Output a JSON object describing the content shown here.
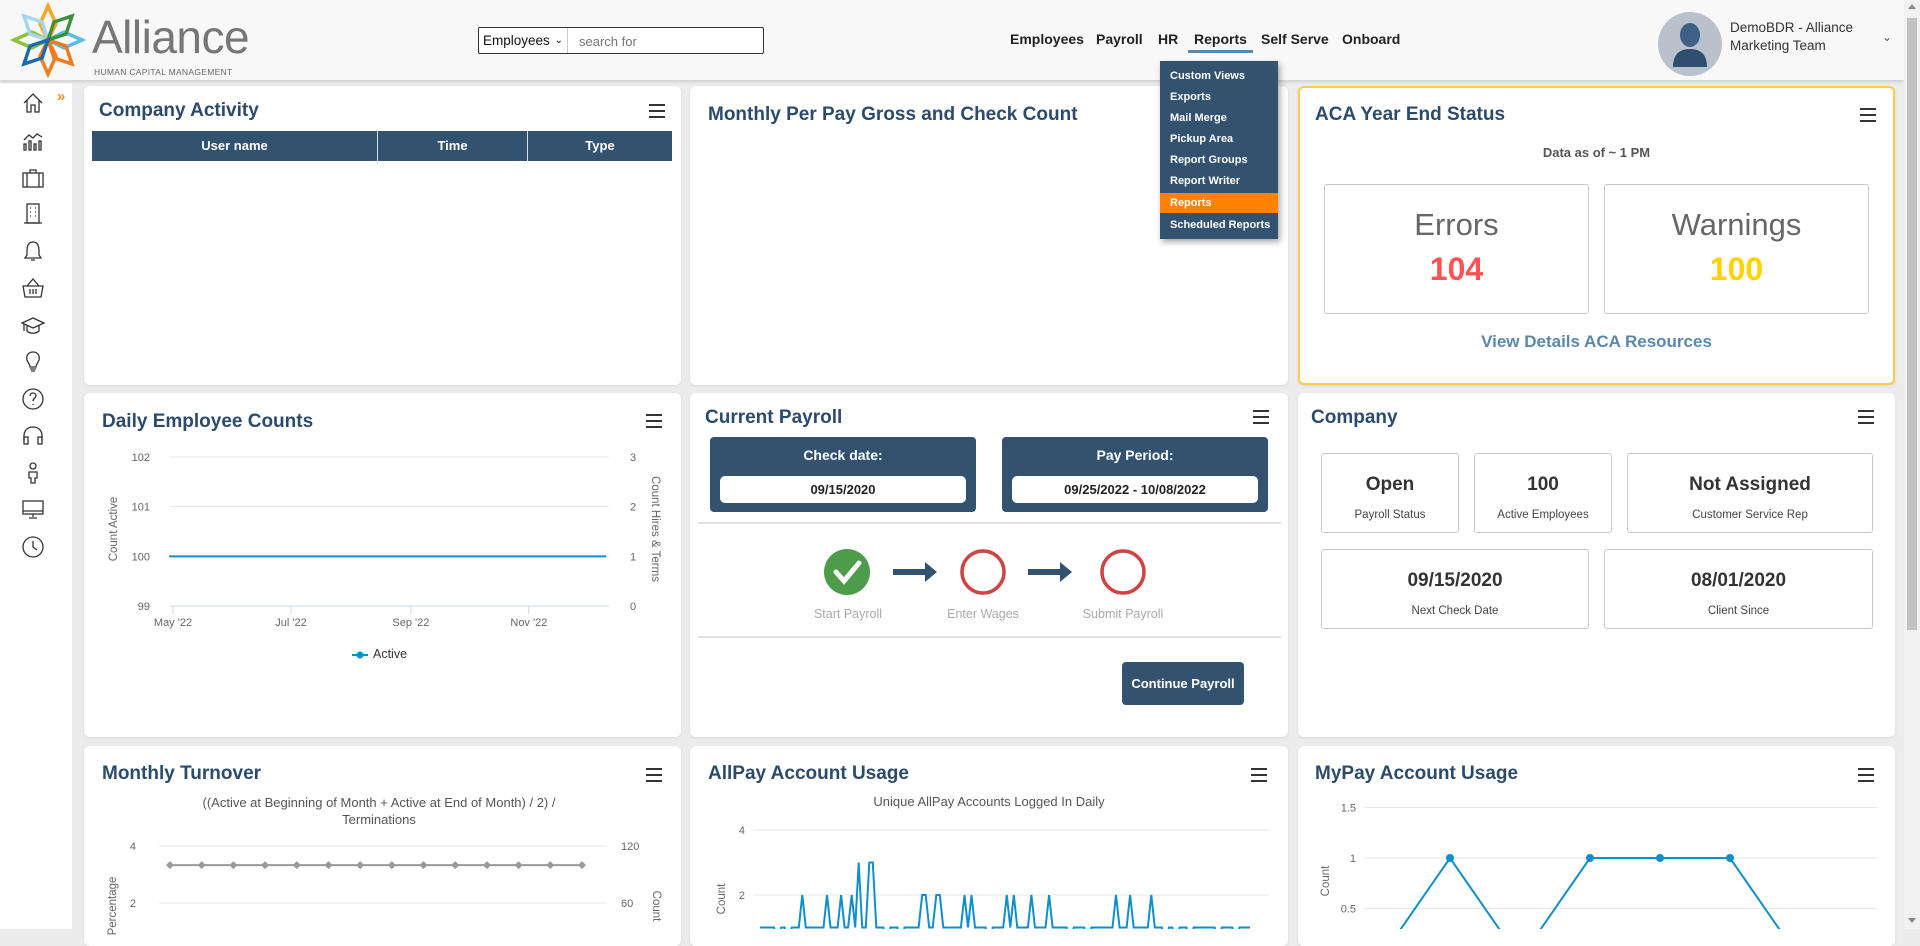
{
  "header": {
    "logo_text": "Alliance",
    "logo_sub": "HUMAN CAPITAL MANAGEMENT",
    "search_scope": "Employees",
    "search_placeholder": "search for",
    "nav": [
      {
        "label": "Employees"
      },
      {
        "label": "Payroll"
      },
      {
        "label": "HR"
      },
      {
        "label": "Reports"
      },
      {
        "label": "Self Serve"
      },
      {
        "label": "Onboard"
      }
    ],
    "active_nav": "Reports",
    "user": {
      "line1": "DemoBDR - Alliance",
      "line2": "Marketing Team"
    }
  },
  "reports_menu": {
    "items": [
      "Custom Views",
      "Exports",
      "Mail Merge",
      "Pickup Area",
      "Report Groups",
      "Report Writer",
      "Reports",
      "Scheduled Reports"
    ],
    "highlighted": "Reports"
  },
  "sidebar": {
    "icons": [
      "home-icon",
      "analytics-icon",
      "briefcase-icon",
      "building-icon",
      "bell-icon",
      "basket-icon",
      "graduation-cap-icon",
      "lightbulb-icon",
      "help-icon",
      "headset-icon",
      "person-icon",
      "monitor-icon",
      "clock-icon"
    ]
  },
  "colors": {
    "title": "#2c4b6b",
    "dark_panel": "#32526f",
    "menu_highlight": "#ff8200",
    "errors": "#ff5252",
    "warnings": "#ffd200",
    "aca_border": "#f9cc4a",
    "link": "#5b87ad",
    "series_blue": "#0f8fcc",
    "series_gray": "#999999",
    "step_complete": "#4c9c4a",
    "step_pending": "#cc4444"
  },
  "company_activity": {
    "title": "Company Activity",
    "columns": [
      "User name",
      "Time",
      "Type"
    ],
    "rows": []
  },
  "monthly_gross": {
    "title": "Monthly Per Pay Gross and Check Count"
  },
  "aca": {
    "title": "ACA Year End Status",
    "data_as_of": "Data as of ~ 1 PM",
    "errors_label": "Errors",
    "errors_value": "104",
    "warnings_label": "Warnings",
    "warnings_value": "100",
    "link": "View Details ACA Resources"
  },
  "daily_counts": {
    "title": "Daily Employee Counts"
  },
  "current_payroll": {
    "title": "Current Payroll",
    "check_date_label": "Check date:",
    "check_date": "09/15/2020",
    "pay_period_label": "Pay Period:",
    "pay_period": "09/25/2022 - 10/08/2022",
    "steps": [
      {
        "label": "Start Payroll",
        "status": "complete"
      },
      {
        "label": "Enter Wages",
        "status": "pending"
      },
      {
        "label": "Submit Payroll",
        "status": "pending"
      }
    ],
    "continue_button": "Continue Payroll"
  },
  "company": {
    "title": "Company",
    "stats": [
      {
        "value": "Open",
        "label": "Payroll Status"
      },
      {
        "value": "100",
        "label": "Active Employees"
      },
      {
        "value": "Not Assigned",
        "label": "Customer Service Rep"
      },
      {
        "value": "09/15/2020",
        "label": "Next Check Date"
      },
      {
        "value": "08/01/2020",
        "label": "Client Since"
      }
    ]
  },
  "monthly_turnover": {
    "title": "Monthly Turnover"
  },
  "allpay": {
    "title": "AllPay Account Usage"
  },
  "mypay": {
    "title": "MyPay Account Usage"
  },
  "chart_data": [
    {
      "type": "line",
      "ylabel": "Count Active",
      "y2label": "Count Hires & Terms",
      "ylim": [
        99,
        102
      ],
      "yticks": [
        99,
        100,
        101,
        102
      ],
      "y2lim": [
        0,
        3
      ],
      "y2ticks": [
        0,
        1,
        2,
        3
      ],
      "xticks": [
        "May '22",
        "Jul '22",
        "Sep '22",
        "Nov '22"
      ],
      "grid": true,
      "legend": "bottom",
      "series": [
        {
          "name": "Active",
          "points": [
            {
              "x": "2022-04-29",
              "y": 100
            },
            {
              "x": "2022-12-11",
              "y": 100
            }
          ]
        }
      ]
    },
    {
      "type": "line",
      "subtitle_line1": "((Active at Beginning of Month + Active at End of Month)  /  2)  /",
      "subtitle_line2": "Terminations",
      "ylabel": "Percentage",
      "y2label": "Count",
      "yticks": [
        2,
        4
      ],
      "y2ticks": [
        60,
        120
      ],
      "grid": true,
      "series": [
        {
          "values": [
            3.33,
            3.33,
            3.33,
            3.33,
            3.33,
            3.33,
            3.33,
            3.33,
            3.33,
            3.33,
            3.33,
            3.33,
            3.33,
            3.33
          ]
        }
      ]
    },
    {
      "type": "line",
      "subtitle": "Unique AllPay Accounts Logged In Daily",
      "ylabel": "Count",
      "yticks": [
        2,
        4
      ],
      "grid": true,
      "series": [
        {
          "values": [
            1,
            1,
            1,
            1,
            1,
            0,
            1,
            1,
            0,
            1,
            1,
            1,
            2,
            1,
            1,
            1,
            1,
            1,
            1,
            2,
            1,
            1,
            1,
            2,
            1,
            1,
            2,
            1,
            3,
            1,
            1,
            3,
            3,
            1,
            1,
            1,
            0,
            1,
            1,
            1,
            0,
            1,
            1,
            1,
            1,
            1,
            2,
            2,
            1,
            1,
            2,
            2,
            1,
            1,
            1,
            1,
            1,
            1,
            2,
            1,
            2,
            1,
            1,
            1,
            1,
            0,
            1,
            1,
            1,
            1,
            2,
            1,
            2,
            1,
            1,
            1,
            1,
            2,
            1,
            1,
            1,
            1,
            2,
            1,
            1,
            1,
            1,
            1,
            0,
            1,
            1,
            1,
            1,
            0,
            1,
            1,
            1,
            1,
            1,
            1,
            1,
            2,
            1,
            1,
            1,
            2,
            1,
            1,
            1,
            1,
            1,
            2,
            1,
            1,
            1,
            0,
            1,
            1,
            0,
            1,
            1,
            1,
            0,
            1,
            1,
            1,
            1,
            1,
            1,
            1,
            0,
            1,
            1,
            1,
            1,
            0,
            1,
            1,
            1,
            1
          ]
        }
      ]
    },
    {
      "type": "line",
      "ylabel": "Count",
      "yticks": [
        0.5,
        1,
        1.5
      ],
      "grid": true,
      "series": [
        {
          "values": [
            0,
            1,
            0,
            1,
            1,
            1,
            0,
            0
          ]
        }
      ]
    }
  ]
}
